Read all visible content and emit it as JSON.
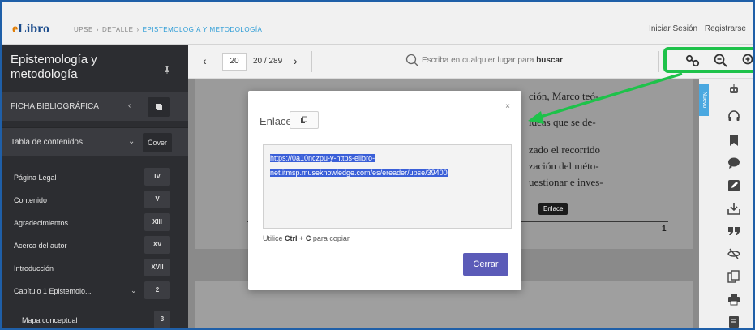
{
  "header": {
    "logo_e": "e",
    "logo_rest": "Libro",
    "breadcrumb": [
      "UPSE",
      "DETALLE",
      "EPISTEMOLOGÍA Y METODOLOGÍA"
    ],
    "breadcrumb_sep": "›",
    "login": "Iniciar Sesión",
    "register": "Registrarse"
  },
  "sidebar": {
    "title": "Epistemología y metodología",
    "ficha_label": "FICHA BIBLIOGRÁFICA",
    "toc_label": "Tabla de contenidos",
    "toc_cover": "Cover",
    "toc": [
      {
        "label": "Página Legal",
        "page": "IV"
      },
      {
        "label": "Contenido",
        "page": "V"
      },
      {
        "label": "Agradecimientos",
        "page": "XIII"
      },
      {
        "label": "Acerca del autor",
        "page": "XV"
      },
      {
        "label": "Introducción",
        "page": "XVII"
      },
      {
        "label": "Capítulo 1 Epistemolo...",
        "page": "2"
      }
    ],
    "sub_item": {
      "label": "Mapa conceptual",
      "page": "3"
    }
  },
  "toolbar": {
    "page_input": "20",
    "page_count": "20 / 289",
    "search_placeholder": "Escriba en cualquier lugar para",
    "search_bold": "buscar"
  },
  "document": {
    "lines": [
      "ción, Marco teó-",
      "ideas que se de-",
      "zado el recorrido",
      "zación del méto-",
      "uestionar e inves-"
    ],
    "page_number": "1",
    "tooltip": "Enlace"
  },
  "right_panel": {
    "new_tag": "Nuevo"
  },
  "modal": {
    "title": "Enlace",
    "link_line1": "https://0a10nczpu-y-https-elibro-",
    "link_line2": "net.itmsp.museknowledge.com/es/ereader/upse/39400",
    "hint_pre": "Utilice",
    "hint_key1": "Ctrl",
    "hint_plus": "+",
    "hint_key2": "C",
    "hint_post": "para copiar",
    "close_x": "×",
    "close_button": "Cerrar"
  },
  "colors": {
    "accent": "#5b5bb8",
    "highlight": "#1ec24a",
    "sidebar": "#2c2d31",
    "selection": "#3a5fd8"
  }
}
